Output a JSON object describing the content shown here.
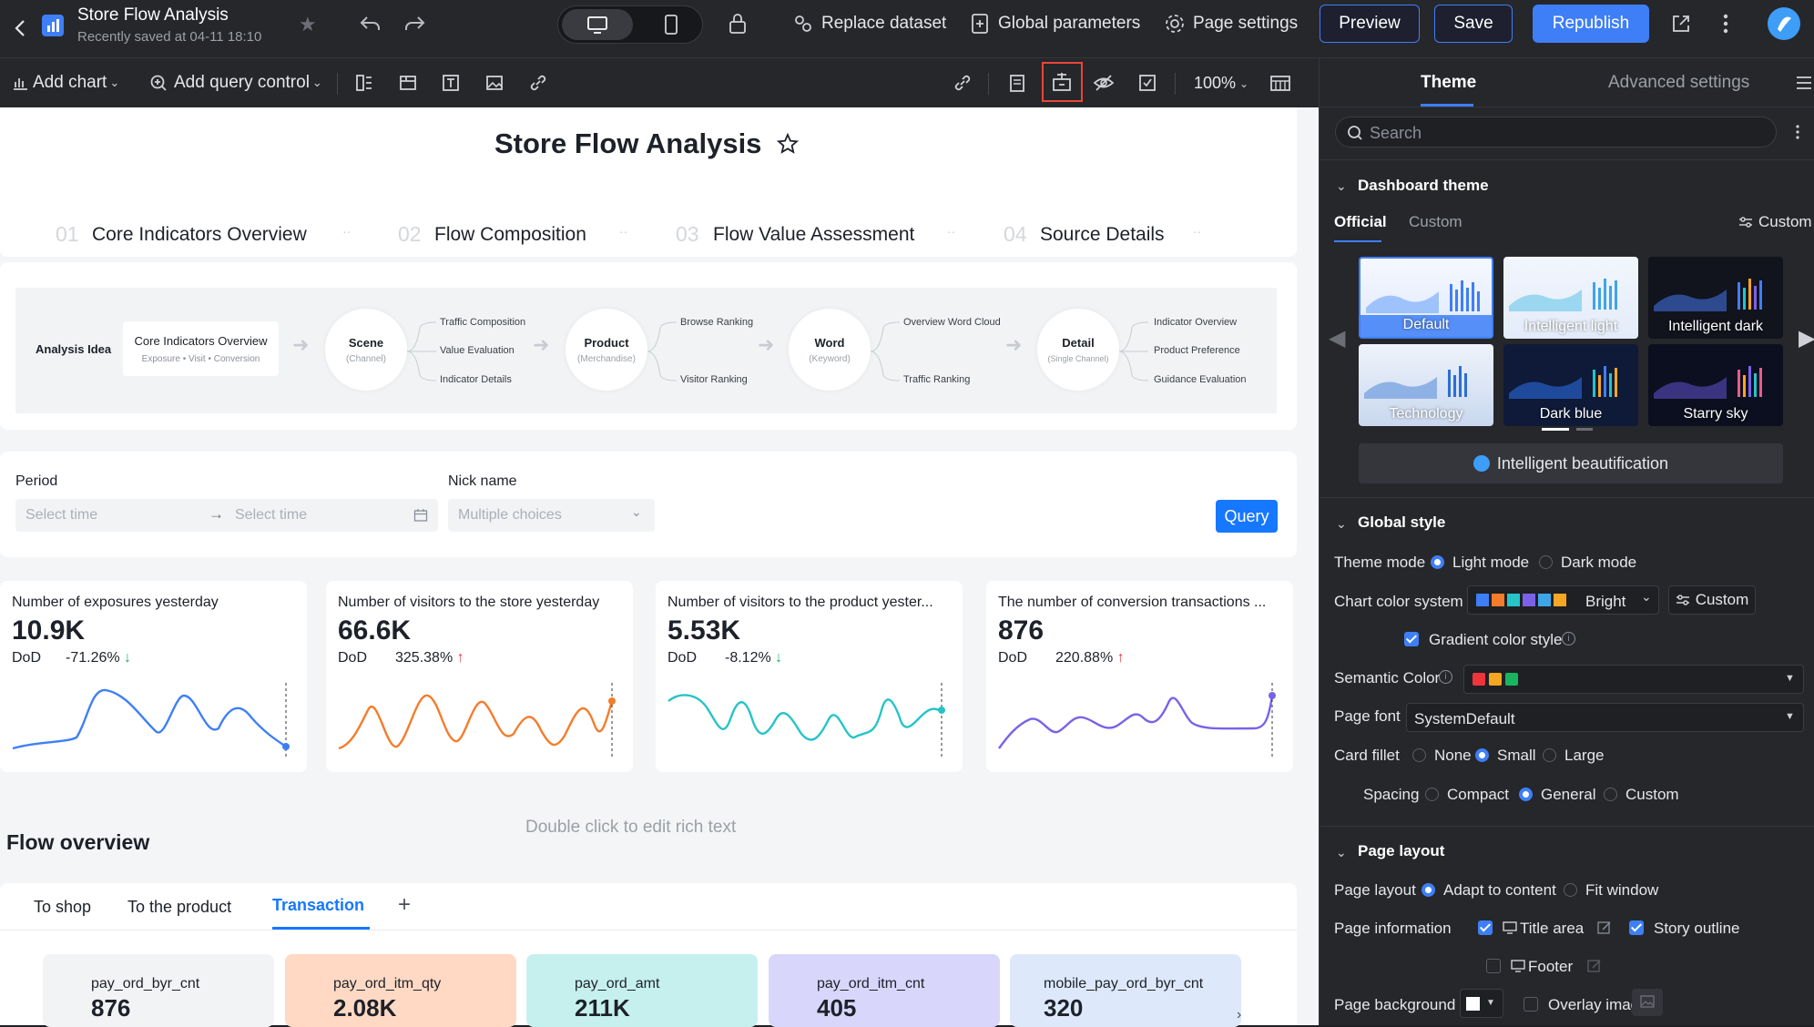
{
  "header": {
    "title": "Store Flow Analysis",
    "saved": "Recently saved at 04-11 18:10",
    "replace_dataset": "Replace dataset",
    "global_parameters": "Global parameters",
    "page_settings": "Page settings",
    "preview": "Preview",
    "save": "Save",
    "republish": "Republish"
  },
  "toolbar": {
    "add_chart": "Add chart",
    "add_query_control": "Add query control",
    "zoom": "100%"
  },
  "dashboard": {
    "title": "Store Flow Analysis",
    "tabs": [
      {
        "num": "01",
        "label": "Core Indicators Overview"
      },
      {
        "num": "02",
        "label": "Flow Composition"
      },
      {
        "num": "03",
        "label": "Flow Value Assessment"
      },
      {
        "num": "04",
        "label": "Source Details"
      }
    ],
    "analysis": {
      "idea": "Analysis Idea",
      "box_title": "Core Indicators Overview",
      "box_sub": "Exposure • Visit • Conversion",
      "nodes": [
        {
          "title": "Scene",
          "sub": "(Channel)",
          "items": [
            "Traffic Composition",
            "Value Evaluation",
            "Indicator Details"
          ]
        },
        {
          "title": "Product",
          "sub": "(Merchandise)",
          "items": [
            "Browse Ranking",
            "Visitor Ranking"
          ]
        },
        {
          "title": "Word",
          "sub": "(Keyword)",
          "items": [
            "Overview Word Cloud",
            "Traffic Ranking"
          ]
        },
        {
          "title": "Detail",
          "sub": "(Single Channel)",
          "items": [
            "Indicator Overview",
            "Product Preference",
            "Guidance Evaluation"
          ]
        }
      ]
    },
    "filters": {
      "period_label": "Period",
      "start_placeholder": "Select time",
      "end_placeholder": "Select time",
      "nick_label": "Nick name",
      "nick_placeholder": "Multiple choices",
      "query": "Query"
    },
    "kpis": [
      {
        "title": "Number of exposures yesterday",
        "value": "10.9K",
        "dod": "DoD",
        "pct": "-71.26%",
        "dir": "down",
        "color": "#3e7ff7"
      },
      {
        "title": "Number of visitors to the store yesterday",
        "value": "66.6K",
        "dod": "DoD",
        "pct": "325.38%",
        "dir": "up",
        "color": "#f57c2a"
      },
      {
        "title": "Number of visitors to the product yester...",
        "value": "5.53K",
        "dod": "DoD",
        "pct": "-8.12%",
        "dir": "down",
        "color": "#25c4c8"
      },
      {
        "title": "The number of conversion transactions ...",
        "value": "876",
        "dod": "DoD",
        "pct": "220.88%",
        "dir": "up",
        "color": "#7b61e8"
      }
    ],
    "rich_text_hint": "Double click to edit rich text",
    "flow_overview": "Flow overview",
    "flow_tabs": [
      "To shop",
      "To the product",
      "Transaction"
    ],
    "flow_tab_add": "+",
    "metrics": [
      {
        "label": "pay_ord_byr_cnt",
        "value": "876",
        "bg": "#f2f3f5"
      },
      {
        "label": "pay_ord_itm_qty",
        "value": "2.08K",
        "bg": "#ffd9c4"
      },
      {
        "label": "pay_ord_amt",
        "value": "211K",
        "bg": "#c6f0ee"
      },
      {
        "label": "pay_ord_itm_cnt",
        "value": "405",
        "bg": "#d9d6fb"
      },
      {
        "label": "mobile_pay_ord_byr_cnt",
        "value": "320",
        "bg": "#dde9fb"
      }
    ]
  },
  "sidebar": {
    "tab_theme": "Theme",
    "tab_advanced": "Advanced settings",
    "search_placeholder": "Search",
    "dashboard_theme": "Dashboard theme",
    "theme_tab_official": "Official",
    "theme_tab_custom": "Custom",
    "custom_link": "Custom",
    "themes": [
      "Default",
      "Intelligent light",
      "Intelligent dark",
      "Technology",
      "Dark blue",
      "Starry sky"
    ],
    "beautify": "Intelligent beautification",
    "global_style": "Global style",
    "theme_mode_label": "Theme mode",
    "light_mode": "Light mode",
    "dark_mode": "Dark mode",
    "chart_color_label": "Chart color system",
    "chart_color_value": "Bright",
    "chart_color_custom": "Custom",
    "gradient_label": "Gradient color style",
    "semantic_label": "Semantic Color",
    "page_font_label": "Page font",
    "page_font_value": "SystemDefault",
    "card_fillet_label": "Card fillet",
    "fillet_none": "None",
    "fillet_small": "Small",
    "fillet_large": "Large",
    "spacing_label": "Spacing",
    "spacing_compact": "Compact",
    "spacing_general": "General",
    "spacing_custom": "Custom",
    "page_layout_section": "Page layout",
    "page_layout_label": "Page layout",
    "adapt": "Adapt to content",
    "fit": "Fit window",
    "page_info_label": "Page information",
    "title_area": "Title area",
    "story_outline": "Story outline",
    "footer": "Footer",
    "page_bg_label": "Page background",
    "overlay": "Overlay image"
  }
}
